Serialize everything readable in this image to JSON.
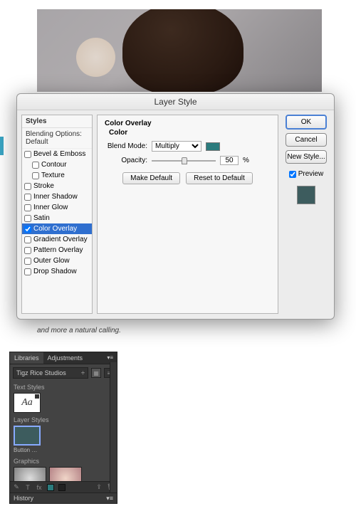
{
  "caption": "and more a natural calling.",
  "dialog": {
    "title": "Layer Style",
    "styles_header": "Styles",
    "blending_options": "Blending Options: Default",
    "effects": [
      {
        "label": "Bevel & Emboss",
        "checked": false,
        "sub": false
      },
      {
        "label": "Contour",
        "checked": false,
        "sub": true
      },
      {
        "label": "Texture",
        "checked": false,
        "sub": true
      },
      {
        "label": "Stroke",
        "checked": false,
        "sub": false
      },
      {
        "label": "Inner Shadow",
        "checked": false,
        "sub": false
      },
      {
        "label": "Inner Glow",
        "checked": false,
        "sub": false
      },
      {
        "label": "Satin",
        "checked": false,
        "sub": false
      },
      {
        "label": "Color Overlay",
        "checked": true,
        "sub": false,
        "selected": true
      },
      {
        "label": "Gradient Overlay",
        "checked": false,
        "sub": false
      },
      {
        "label": "Pattern Overlay",
        "checked": false,
        "sub": false
      },
      {
        "label": "Outer Glow",
        "checked": false,
        "sub": false
      },
      {
        "label": "Drop Shadow",
        "checked": false,
        "sub": false
      }
    ],
    "group_title": "Color Overlay",
    "sub_title": "Color",
    "blend_label": "Blend Mode:",
    "blend_value": "Multiply",
    "overlay_color": "#2b7b7d",
    "opacity_label": "Opacity:",
    "opacity_value": "50",
    "opacity_unit": "%",
    "make_default": "Make Default",
    "reset_default": "Reset to Default",
    "ok": "OK",
    "cancel": "Cancel",
    "new_style": "New Style...",
    "preview_label": "Preview",
    "preview_checked": true,
    "preview_color": "#3d5c5e"
  },
  "libraries": {
    "tab1": "Libraries",
    "tab2": "Adjustments",
    "dropdown": "Tigz Rice Studios",
    "text_styles": "Text Styles",
    "aa": "Aa",
    "layer_styles": "Layer Styles",
    "ls_caption": "Button St...",
    "graphics": "Graphics",
    "history": "History"
  }
}
